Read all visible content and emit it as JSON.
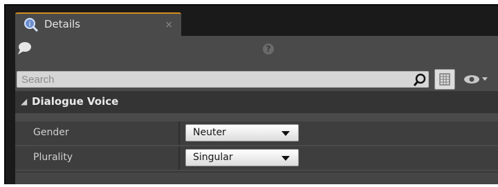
{
  "tab": {
    "title": "Details",
    "close": "×",
    "icon": "details-magnifier-icon"
  },
  "toolbar": {
    "help": "?"
  },
  "search": {
    "placeholder": "Search"
  },
  "category": {
    "label": "Dialogue Voice"
  },
  "properties": [
    {
      "name": "Gender",
      "value": "Neuter"
    },
    {
      "name": "Plurality",
      "value": "Singular"
    }
  ],
  "colors": {
    "tab_accent": "#d98e1f",
    "panel": "#4a4a4a",
    "category": "#343434"
  }
}
